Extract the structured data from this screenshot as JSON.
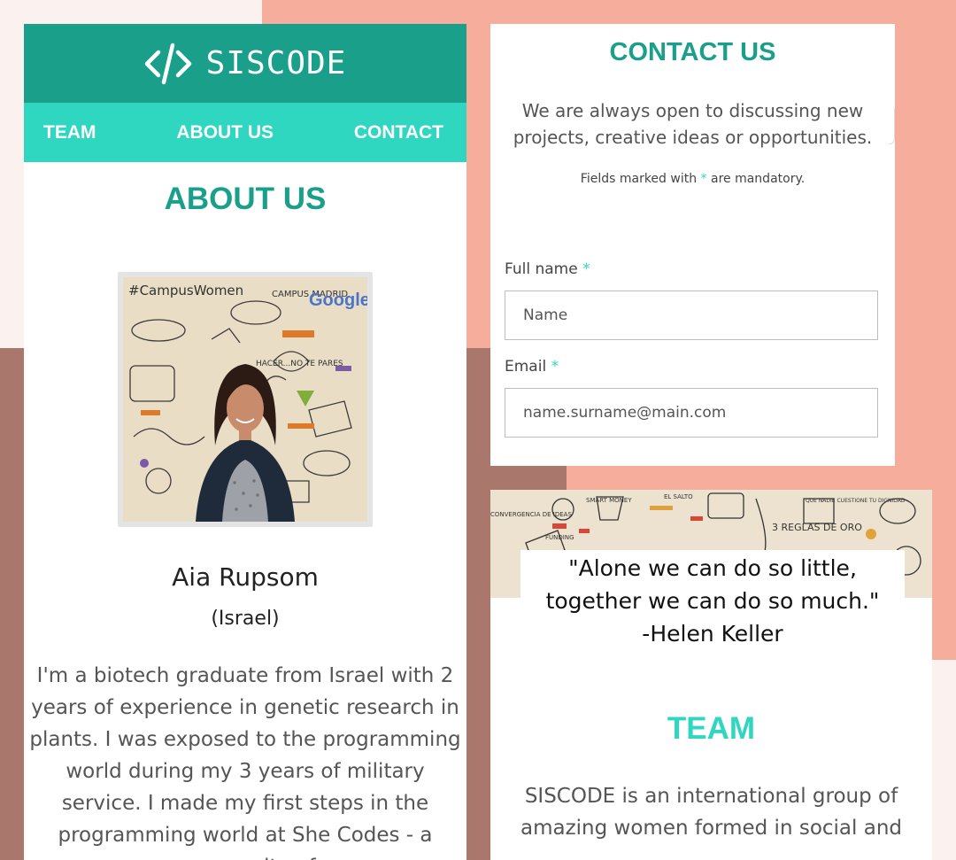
{
  "colors": {
    "brand_dark": "#1aa08a",
    "brand_light": "#2fd7c0",
    "salmon": "#f7ad9b",
    "brown": "#a9776c",
    "pale": "#fbf1ee"
  },
  "left_panel": {
    "brand": {
      "name": "SISCODE",
      "icon": "code-brackets-icon"
    },
    "nav": [
      "TEAM",
      "ABOUT US",
      "CONTACT"
    ],
    "about_title": "ABOUT US",
    "photo": {
      "mural_words": [
        "#CampusWomen",
        "CAMPUS MADRID",
        "Google",
        "HACER...NO TE PARES"
      ]
    },
    "person_name": "Aia Rupsom",
    "person_country": "(Israel)",
    "person_bio": "I'm a biotech graduate from Israel with 2 years of experience in genetic research in plants. I was exposed to the programming world during my 3 years of military service. I made my first steps in the programming world at She Codes - a community of"
  },
  "contact_panel": {
    "title": "CONTACT US",
    "intro": "We are always open to discussing new projects, creative ideas or opportunities.",
    "note_before": "Fields marked with",
    "note_star": "*",
    "note_after": "are mandatory.",
    "fields": [
      {
        "label": "Full name",
        "required": "*",
        "placeholder": "Name"
      },
      {
        "label": "Email",
        "required": "*",
        "placeholder": "name.surname@main.com"
      }
    ]
  },
  "team_panel": {
    "mural_words": [
      "CONVERGENCIA DE IDEAS",
      "SMART MONEY",
      "FUNDING",
      "EL SALTO",
      "QUE NADIE CUESTIONE TU DIGNIDAD",
      "3 REGLAS DE ORO"
    ],
    "quote_lines": [
      "\"Alone we can do so little,",
      "together we can do so much.\"",
      "-Helen Keller"
    ],
    "title": "TEAM",
    "text": "SISCODE is an international group of amazing women formed in social and"
  }
}
